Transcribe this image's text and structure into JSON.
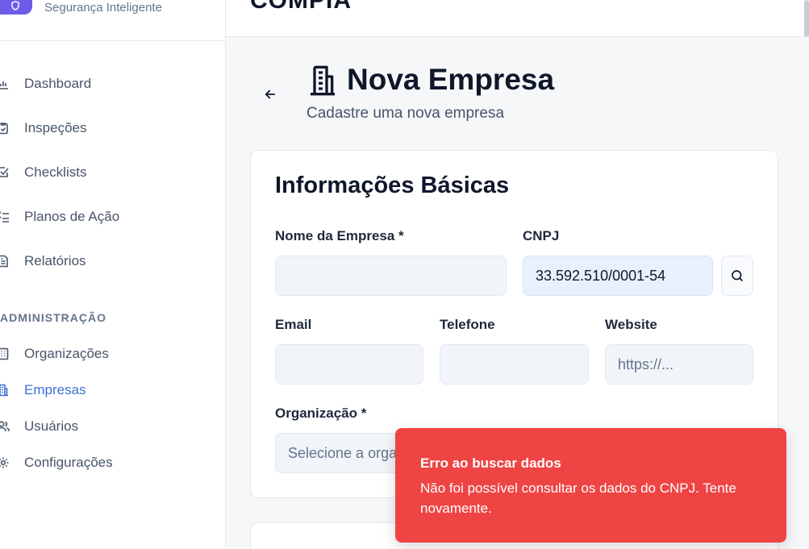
{
  "brand": {
    "subtitle": "Segurança Inteligente",
    "logo_color": "#6d5ce8"
  },
  "app": {
    "title": "COMPIA"
  },
  "sidebar": {
    "items": [
      {
        "label": "Dashboard",
        "icon": "bar-chart-icon"
      },
      {
        "label": "Inspeções",
        "icon": "clipboard-check-icon"
      },
      {
        "label": "Checklists",
        "icon": "square-check-icon"
      },
      {
        "label": "Planos de Ação",
        "icon": "list-checks-icon"
      },
      {
        "label": "Relatórios",
        "icon": "file-text-icon"
      }
    ],
    "admin_title": "ADMINISTRAÇÃO",
    "admin_items": [
      {
        "label": "Organizações",
        "icon": "building-icon"
      },
      {
        "label": "Empresas",
        "icon": "building-2-icon",
        "active": true
      },
      {
        "label": "Usuários",
        "icon": "users-icon"
      },
      {
        "label": "Configurações",
        "icon": "gear-icon"
      }
    ],
    "active_color": "#3b6fd4"
  },
  "header": {
    "title": "Nova Empresa",
    "subtitle": "Cadastre uma nova empresa"
  },
  "form": {
    "section_title": "Informações Básicas",
    "company_name": {
      "label": "Nome da Empresa *",
      "value": ""
    },
    "cnpj": {
      "label": "CNPJ",
      "value": "33.592.510/0001-54"
    },
    "email": {
      "label": "Email",
      "value": ""
    },
    "phone": {
      "label": "Telefone",
      "value": ""
    },
    "website": {
      "label": "Website",
      "placeholder": "https://..."
    },
    "organization": {
      "label": "Organização *",
      "placeholder": "Selecione a organização"
    }
  },
  "toast": {
    "title": "Erro ao buscar dados",
    "message": "Não foi possível consultar os dados do CNPJ. Tente novamente.",
    "color": "#ef4444"
  }
}
